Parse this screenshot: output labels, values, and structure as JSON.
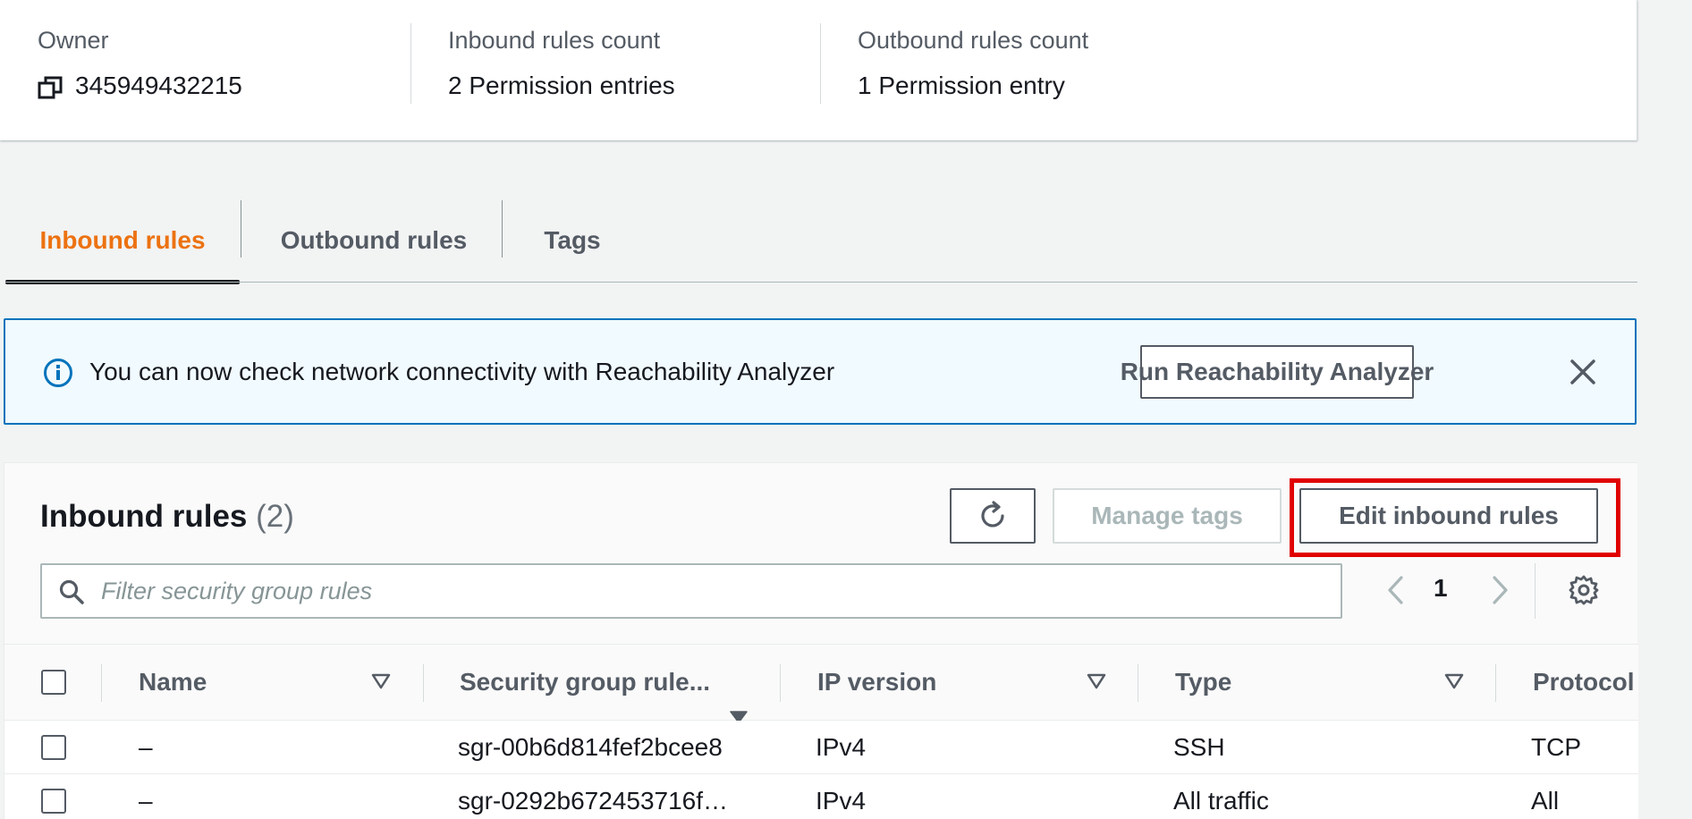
{
  "summary": {
    "owner_label": "Owner",
    "owner_value": "345949432215",
    "inbound_label": "Inbound rules count",
    "inbound_value": "2 Permission entries",
    "outbound_label": "Outbound rules count",
    "outbound_value": "1 Permission entry"
  },
  "tabs": [
    {
      "label": "Inbound rules",
      "active": true
    },
    {
      "label": "Outbound rules",
      "active": false
    },
    {
      "label": "Tags",
      "active": false
    }
  ],
  "alert": {
    "message": "You can now check network connectivity with Reachability Analyzer",
    "button_label": "Run Reachability Analyzer",
    "icon": "info-icon",
    "close_icon": "close-icon"
  },
  "inbound_table": {
    "title": "Inbound rules",
    "count": "(2)",
    "manage_tags_label": "Manage tags",
    "edit_label": "Edit inbound rules",
    "filter_placeholder": "Filter security group rules",
    "page_number": "1",
    "columns": [
      "Name",
      "Security group rule...",
      "IP version",
      "Type",
      "Protocol"
    ],
    "rows": [
      {
        "name": "–",
        "rule_id": "sgr-00b6d814fef2bcee8",
        "ip_version": "IPv4",
        "type": "SSH",
        "protocol": "TCP"
      },
      {
        "name": "–",
        "rule_id": "sgr-0292b672453716f…",
        "ip_version": "IPv4",
        "type": "All traffic",
        "protocol": "All"
      }
    ]
  },
  "colors": {
    "accent_orange": "#ec7211",
    "info_blue": "#0073bb",
    "highlight_red": "#e00000"
  }
}
